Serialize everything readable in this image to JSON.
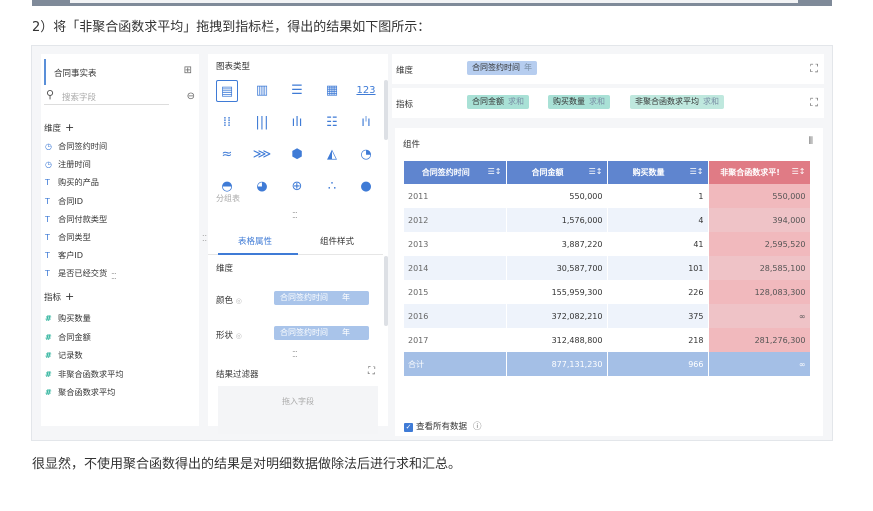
{
  "caption": "2）将「非聚合函数求平均」拖拽到指标栏，得出的结果如下图所示：",
  "footer": "很显然，不使用聚合函数得出的结果是对明细数据做除法后进行求和汇总。",
  "left": {
    "dataset": "合同事实表",
    "search_placeholder": "搜索字段",
    "dim_header": "维度",
    "dimensions": [
      {
        "icon": "clock-icon",
        "glyph": "◷",
        "label": "合同签约时间"
      },
      {
        "icon": "clock-icon",
        "glyph": "◷",
        "label": "注册时间"
      },
      {
        "icon": "text-icon",
        "glyph": "T",
        "label": "购买的产品"
      },
      {
        "icon": "text-icon",
        "glyph": "T",
        "label": "合同ID"
      },
      {
        "icon": "text-icon",
        "glyph": "T",
        "label": "合同付款类型"
      },
      {
        "icon": "text-icon",
        "glyph": "T",
        "label": "合同类型"
      },
      {
        "icon": "text-icon",
        "glyph": "T",
        "label": "客户ID"
      },
      {
        "icon": "text-icon",
        "glyph": "T",
        "label": "是否已经交货"
      }
    ],
    "measure_header": "指标",
    "measures": [
      {
        "icon": "hash-icon",
        "glyph": "#",
        "label": "购买数量"
      },
      {
        "icon": "hash-icon",
        "glyph": "#",
        "label": "合同金额"
      },
      {
        "icon": "hash-icon",
        "glyph": "#",
        "label": "记录数"
      },
      {
        "icon": "formula-hash-icon",
        "glyph": "#",
        "label": "非聚合函数求平均"
      },
      {
        "icon": "formula-hash-icon",
        "glyph": "#",
        "label": "聚合函数求平均"
      }
    ]
  },
  "middle": {
    "chart_type_label": "图表类型",
    "group_label": "分组表",
    "tab_table": "表格属性",
    "tab_style": "组件样式",
    "dim_label": "维度",
    "color_label": "颜色",
    "shape_label": "形状",
    "color_pill": "合同签约时间",
    "color_pill_unit": "年",
    "shape_pill": "合同签约时间",
    "shape_pill_unit": "年",
    "filter_label": "结果过滤器",
    "drop_text": "拖入字段"
  },
  "right": {
    "dim_label": "维度",
    "dim_chip": "合同签约时间",
    "dim_chip_agg": "年",
    "measure_label": "指标",
    "chips": [
      {
        "label": "合同金额",
        "agg": "求和"
      },
      {
        "label": "购买数量",
        "agg": "求和"
      },
      {
        "label": "非聚合函数求平均",
        "agg": "求和"
      }
    ],
    "component_label": "组件",
    "check_label": "查看所有数据"
  },
  "table": {
    "headers": [
      "合同签约时间",
      "合同金额",
      "购买数量",
      "非聚合函数求平!"
    ],
    "rows": [
      [
        "2011",
        "550,000",
        "1",
        "550,000"
      ],
      [
        "2012",
        "1,576,000",
        "4",
        "394,000"
      ],
      [
        "2013",
        "3,887,220",
        "41",
        "2,595,520"
      ],
      [
        "2014",
        "30,587,700",
        "101",
        "28,585,100"
      ],
      [
        "2015",
        "155,959,300",
        "226",
        "128,083,300"
      ],
      [
        "2016",
        "372,082,210",
        "375",
        "∞"
      ],
      [
        "2017",
        "312,488,800",
        "218",
        "281,276,300"
      ]
    ],
    "total": [
      "合计",
      "877,131,230",
      "966",
      "∞"
    ]
  }
}
